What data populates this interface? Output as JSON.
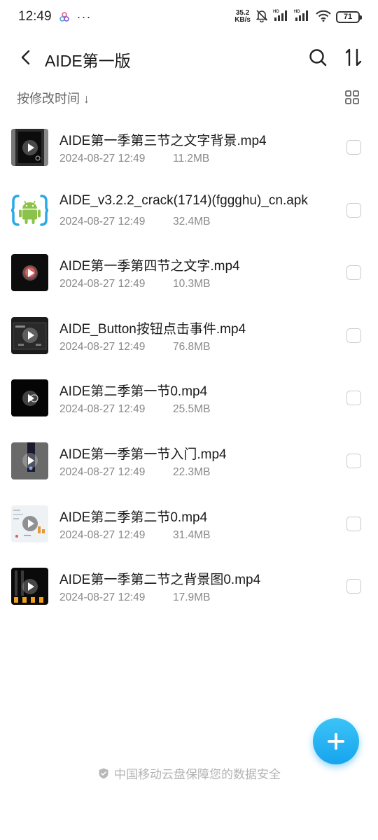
{
  "status_bar": {
    "time": "12:49",
    "more": "···",
    "net_speed_value": "35.2",
    "net_speed_unit": "KB/s",
    "battery": "71"
  },
  "header": {
    "title": "AIDE第一版"
  },
  "sort": {
    "label": "按修改时间 ↓"
  },
  "files": [
    {
      "name": "AIDE第一季第三节之文字背景.mp4",
      "date": "2024-08-27 12:49",
      "size": "11.2MB",
      "thumb": "dark"
    },
    {
      "name": "AIDE_v3.2.2_crack(1714)(fggghu)_cn.apk",
      "date": "2024-08-27 12:49",
      "size": "32.4MB",
      "thumb": "apk"
    },
    {
      "name": "AIDE第一季第四节之文字.mp4",
      "date": "2024-08-27 12:49",
      "size": "10.3MB",
      "thumb": "dark"
    },
    {
      "name": "AIDE_Button按钮点击事件.mp4",
      "date": "2024-08-27 12:49",
      "size": "76.8MB",
      "thumb": "dark"
    },
    {
      "name": "AIDE第二季第一节0.mp4",
      "date": "2024-08-27 12:49",
      "size": "25.5MB",
      "thumb": "dark"
    },
    {
      "name": "AIDE第一季第一节入门.mp4",
      "date": "2024-08-27 12:49",
      "size": "22.3MB",
      "thumb": "gray"
    },
    {
      "name": "AIDE第二季第二节0.mp4",
      "date": "2024-08-27 12:49",
      "size": "31.4MB",
      "thumb": "light"
    },
    {
      "name": "AIDE第一季第二节之背景图0.mp4",
      "date": "2024-08-27 12:49",
      "size": "17.9MB",
      "thumb": "dark"
    }
  ],
  "footer": {
    "text": "中国移动云盘保障您的数据安全"
  },
  "colors": {
    "accent": "#16a4ee",
    "text_primary": "#1a1a1a",
    "text_secondary": "#888888"
  }
}
